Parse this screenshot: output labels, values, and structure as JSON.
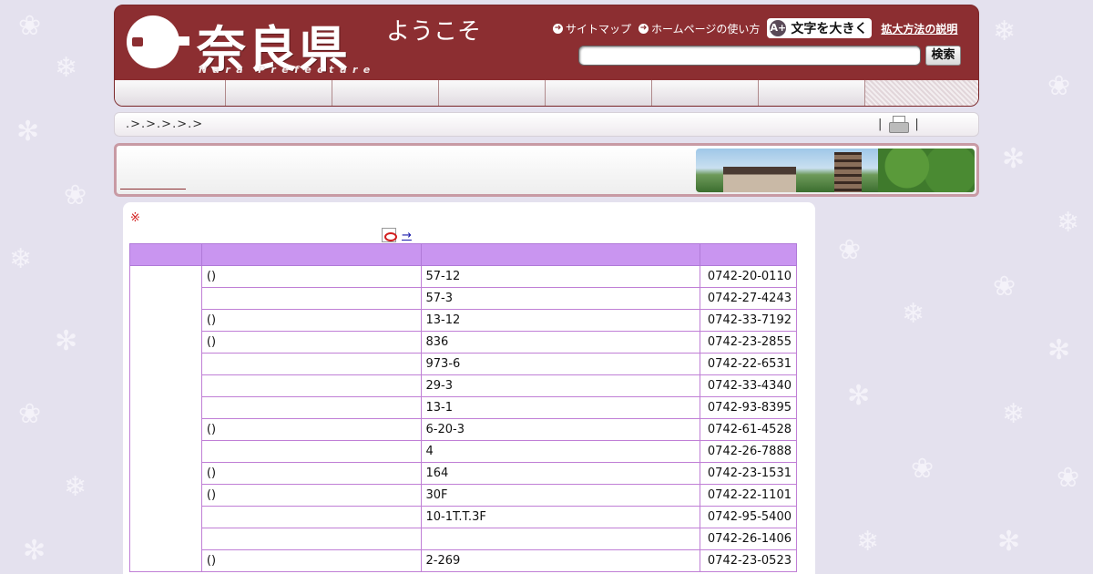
{
  "header": {
    "logo_title": "奈良県",
    "logo_sub": "Nara Prefecture",
    "welcome": "ようこそ",
    "links": [
      "サイトマップ",
      "ホームページの使い方"
    ],
    "enlarge_label": "文字を大きく",
    "enlarge_icon": "A+",
    "howto_label": "拡大方法の説明",
    "search_value": "",
    "search_button": "検索"
  },
  "breadcrumb": {
    "text": ".>.>.>.>.>",
    "print_left": "|",
    "print_right": "|"
  },
  "content": {
    "note_mark": "※",
    "pdf_arrow": "→",
    "pdf_link": "",
    "rows": [
      {
        "name": "()",
        "address": "57-12",
        "tel": "0742-20-0110"
      },
      {
        "name": "",
        "address": "57-3",
        "tel": "0742-27-4243"
      },
      {
        "name": "()",
        "address": "13-12",
        "tel": "0742-33-7192"
      },
      {
        "name": "()",
        "address": "836",
        "tel": "0742-23-2855"
      },
      {
        "name": "",
        "address": "973-6",
        "tel": "0742-22-6531"
      },
      {
        "name": "",
        "address": "29-3",
        "tel": "0742-33-4340"
      },
      {
        "name": "",
        "address": "13-1",
        "tel": "0742-93-8395"
      },
      {
        "name": "()",
        "address": "6-20-3",
        "tel": "0742-61-4528"
      },
      {
        "name": "",
        "address": "4",
        "tel": "0742-26-7888"
      },
      {
        "name": "()",
        "address": "164",
        "tel": "0742-23-1531"
      },
      {
        "name": "()",
        "address": "30F",
        "tel": "0742-22-1101"
      },
      {
        "name": "",
        "address": "10-1T.T.3F",
        "tel": "0742-95-5400"
      },
      {
        "name": "",
        "address": "",
        "tel": "0742-26-1406"
      },
      {
        "name": "()",
        "address": "2-269",
        "tel": "0742-23-0523"
      }
    ]
  }
}
